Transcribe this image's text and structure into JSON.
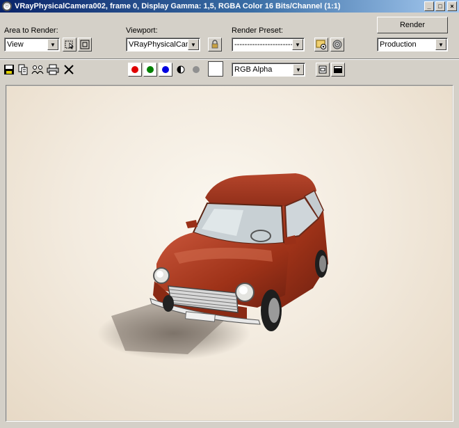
{
  "window": {
    "title": "VRayPhysicalCamera002, frame 0, Display Gamma: 1,5, RGBA Color 16 Bits/Channel (1:1)",
    "minimize": "_",
    "maximize": "□",
    "close": "×"
  },
  "toolbar": {
    "area_label": "Area to Render:",
    "area_value": "View",
    "viewport_label": "Viewport:",
    "viewport_value": "VRayPhysicalCame",
    "preset_label": "Render Preset:",
    "preset_value": "--------------------------",
    "render_label": "Render",
    "mode_value": "Production"
  },
  "channels": {
    "display_value": "RGB Alpha",
    "colors": {
      "red": "#e00000",
      "green": "#008000",
      "blue": "#0000e0",
      "mono": "#909090",
      "swatch": "#ffffff"
    }
  },
  "icons": [
    "edit-region-icon",
    "auto-region-icon",
    "lock-icon",
    "render-setup-icon",
    "environment-icon",
    "save-icon",
    "copy-icon",
    "clone-icon",
    "print-icon",
    "clear-icon",
    "alpha-icon",
    "single-channel-icon",
    "display-toggle-icon",
    "frame-window-icon"
  ]
}
